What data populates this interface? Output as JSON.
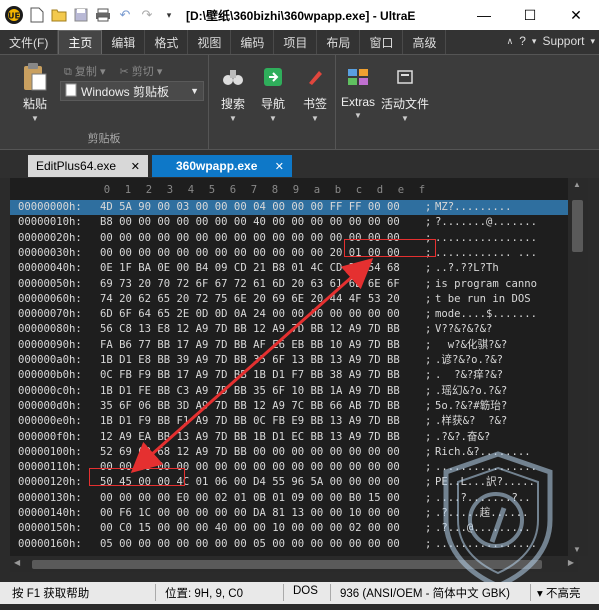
{
  "title": "[D:\\壁纸\\360bizhi\\360wpapp.exe] - UltraE",
  "quick_access": [
    "new-file-icon",
    "open-folder-icon",
    "save-icon",
    "print-icon",
    "undo-icon",
    "redo-icon",
    "dropdown-icon"
  ],
  "ribbon_tabs": [
    "文件(F)",
    "主页",
    "编辑",
    "格式",
    "视图",
    "编码",
    "项目",
    "布局",
    "窗口",
    "高级"
  ],
  "active_tab": "主页",
  "ribbon_right": {
    "help": "?",
    "support": "Support"
  },
  "ribbon": {
    "paste": "粘贴",
    "copy": "复制",
    "cut": "剪切",
    "clipboard_select": "Windows 剪贴板",
    "clipboard_group": "剪贴板",
    "search": "搜索",
    "navigate": "导航",
    "bookmark": "书签",
    "extras": "Extras",
    "active_file": "活动文件"
  },
  "doc_tabs": [
    {
      "name": "EditPlus64.exe",
      "active": false
    },
    {
      "name": "360wpapp.exe",
      "active": true
    }
  ],
  "hex": {
    "columns": [
      "0",
      "1",
      "2",
      "3",
      "4",
      "5",
      "6",
      "7",
      "8",
      "9",
      "a",
      "b",
      "c",
      "d",
      "e",
      "f"
    ],
    "rows": [
      {
        "off": "00000000h:",
        "bytes": "4D 5A 90 00 03 00 00 00 04 00 00 00 FF FF 00 00",
        "asc": "MZ?........."
      },
      {
        "off": "00000010h:",
        "bytes": "B8 00 00 00 00 00 00 00 40 00 00 00 00 00 00 00",
        "asc": "?.......@......."
      },
      {
        "off": "00000020h:",
        "bytes": "00 00 00 00 00 00 00 00 00 00 00 00 00 00 00 00",
        "asc": "................"
      },
      {
        "off": "00000030h:",
        "bytes": "00 00 00 00 00 00 00 00 00 00 00 00 20 01 00 00",
        "asc": "............ ..."
      },
      {
        "off": "00000040h:",
        "bytes": "0E 1F BA 0E 00 B4 09 CD 21 B8 01 4C CD 21 54 68",
        "asc": "..?.??L?Th"
      },
      {
        "off": "00000050h:",
        "bytes": "69 73 20 70 72 6F 67 72 61 6D 20 63 61 6E 6E 6F",
        "asc": "is program canno"
      },
      {
        "off": "00000060h:",
        "bytes": "74 20 62 65 20 72 75 6E 20 69 6E 20 44 4F 53 20",
        "asc": "t be run in DOS "
      },
      {
        "off": "00000070h:",
        "bytes": "6D 6F 64 65 2E 0D 0D 0A 24 00 00 00 00 00 00 00",
        "asc": "mode....$......."
      },
      {
        "off": "00000080h:",
        "bytes": "56 C8 13 E8 12 A9 7D BB 12 A9 7D BB 12 A9 7D BB",
        "asc": "V??&?&?&?"
      },
      {
        "off": "00000090h:",
        "bytes": "FA B6 77 BB 17 A9 7D BB AF E6 EB BB 10 A9 7D BB",
        "asc": "  w?&化骐?&?"
      },
      {
        "off": "000000a0h:",
        "bytes": "1B D1 E8 BB 39 A9 7D BB 35 6F 13 BB 13 A9 7D BB",
        "asc": ".谚?&?o.?&?"
      },
      {
        "off": "000000b0h:",
        "bytes": "0C FB F9 BB 17 A9 7D BB 1B D1 F7 BB 38 A9 7D BB",
        "asc": ".  ?&?痒?&?"
      },
      {
        "off": "000000c0h:",
        "bytes": "1B D1 FE BB C3 A9 7D BB 35 6F 10 BB 1A A9 7D BB",
        "asc": ".瑶幻&?o.?&?"
      },
      {
        "off": "000000d0h:",
        "bytes": "35 6F 06 BB 3D A9 7D BB 12 A9 7C BB 66 AB 7D BB",
        "asc": "5o.?&?#簕珆?"
      },
      {
        "off": "000000e0h:",
        "bytes": "1B D1 F9 BB F1 A9 7D BB 0C FB E9 BB 13 A9 7D BB",
        "asc": ".样获&?  ?&?"
      },
      {
        "off": "000000f0h:",
        "bytes": "12 A9 EA BB 13 A9 7D BB 1B D1 EC BB 13 A9 7D BB",
        "asc": ".?&?.奋&?"
      },
      {
        "off": "00000100h:",
        "bytes": "52 69 63 68 12 A9 7D BB 00 00 00 00 00 00 00 00",
        "asc": "Rich.&?........"
      },
      {
        "off": "00000110h:",
        "bytes": "00 00 00 00 00 00 00 00 00 00 00 00 00 00 00 00",
        "asc": "................"
      },
      {
        "off": "00000120h:",
        "bytes": "50 45 00 00 4C 01 06 00 D4 55 96 5A 00 00 00 00",
        "asc": "PE..L...訳?....."
      },
      {
        "off": "00000130h:",
        "bytes": "00 00 00 00 E0 00 02 01 0B 01 09 00 00 B0 15 00",
        "asc": "....?.......?.."
      },
      {
        "off": "00000140h:",
        "bytes": "00 F6 1C 00 00 00 00 00 DA 81 13 00 00 10 00 00",
        "asc": ".?.....趤......"
      },
      {
        "off": "00000150h:",
        "bytes": "00 C0 15 00 00 00 40 00 00 10 00 00 00 02 00 00",
        "asc": ".?...@........."
      },
      {
        "off": "00000160h:",
        "bytes": "05 00 00 00 00 00 00 00 05 00 00 00 00 00 00 00",
        "asc": "................"
      }
    ]
  },
  "status": {
    "help": "按 F1 获取帮助",
    "position": "位置: 9H, 9, C0",
    "eol": "DOS",
    "codepage": "936  (ANSI/OEM - 简体中文 GBK)",
    "mode": "不高亮"
  }
}
